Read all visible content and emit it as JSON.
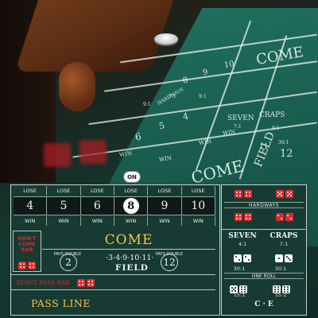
{
  "background": {
    "texts": [
      "COME",
      "FIELD",
      "PASS LINE",
      "COME",
      "HARDWAYS",
      "SEVEN",
      "CRAPS",
      "WIN",
      "WIN",
      "WIN",
      "WIN",
      "6",
      "5",
      "4",
      "8",
      "9",
      "10",
      "7:1",
      "9:1",
      "30:1",
      "2",
      "3",
      "4",
      "9",
      "10",
      "11",
      "12",
      "7:1",
      "9:1",
      "9:1"
    ]
  },
  "on_puck": "ON",
  "point_row": {
    "lose_label": "LOSE",
    "win_label": "WIN",
    "numbers": [
      "4",
      "5",
      "6",
      "8",
      "9",
      "10"
    ],
    "active_index": 3
  },
  "dont_come_bar": "DON'T COME BAR",
  "come_label": "COME",
  "field": {
    "numbers": "·3·4·9·10·11·",
    "label": "FIELD",
    "pays_double_left": "PAYS DOUBLE",
    "pays_double_right": "PAYS DOUBLE",
    "left_num": "2",
    "right_num": "12"
  },
  "dont_pass_bar": "DON'T PASS BAR",
  "pass_line": "PASS LINE",
  "props": {
    "hardways_label": "HARDWAYS",
    "seven": {
      "title": "SEVEN",
      "odds": "4:1"
    },
    "craps": {
      "title": "CRAPS",
      "odds": "7:1"
    },
    "odds_row1": [
      "30:1",
      "30:1"
    ],
    "one_roll_label": "ONE ROLL",
    "odds_row2": [
      "15:1",
      "15:1"
    ],
    "ce_label": "C · E"
  },
  "colors": {
    "felt": "#173b33",
    "gold_text": "#f3c54a",
    "red_text": "#e1242a",
    "die_red": "#e02a2f"
  }
}
